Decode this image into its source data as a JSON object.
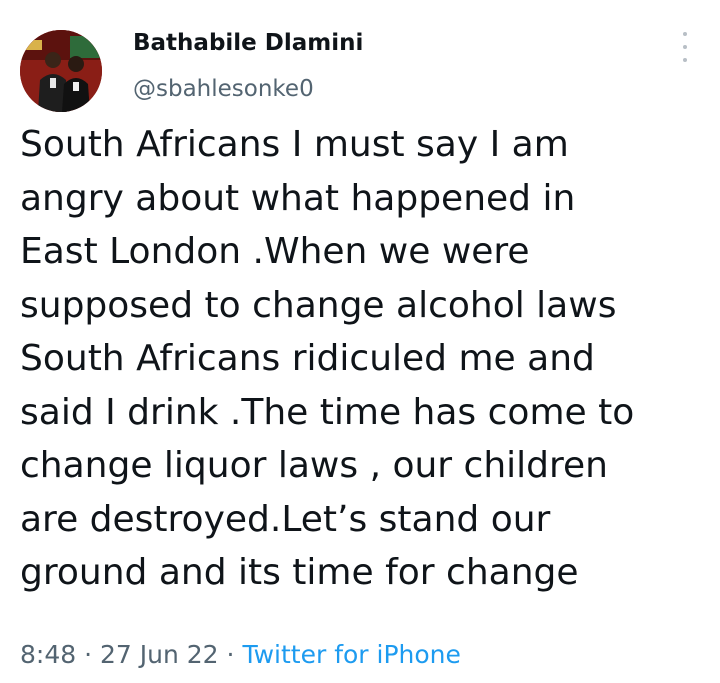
{
  "author": {
    "display_name": "Bathabile Dlamini",
    "handle": "@sbahlesonke0",
    "avatar_icon": "profile-photo-avatar"
  },
  "more_icon": "vertical-ellipsis-icon",
  "tweet": {
    "text": "South Africans I must say I am\nangry about what happened in\nEast London .When we were\nsupposed to change alcohol laws\nSouth Africans ridiculed me and\nsaid I drink .The time has come to\nchange liquor laws , our children\nare destroyed.Let’s stand our\nground and its time for change"
  },
  "meta": {
    "time": "8:48",
    "separator": "·",
    "date": "27 Jun 22",
    "source": "Twitter for iPhone"
  },
  "colors": {
    "text_primary": "#0f1419",
    "text_secondary": "#536471",
    "link_blue": "#1d9bf0"
  }
}
